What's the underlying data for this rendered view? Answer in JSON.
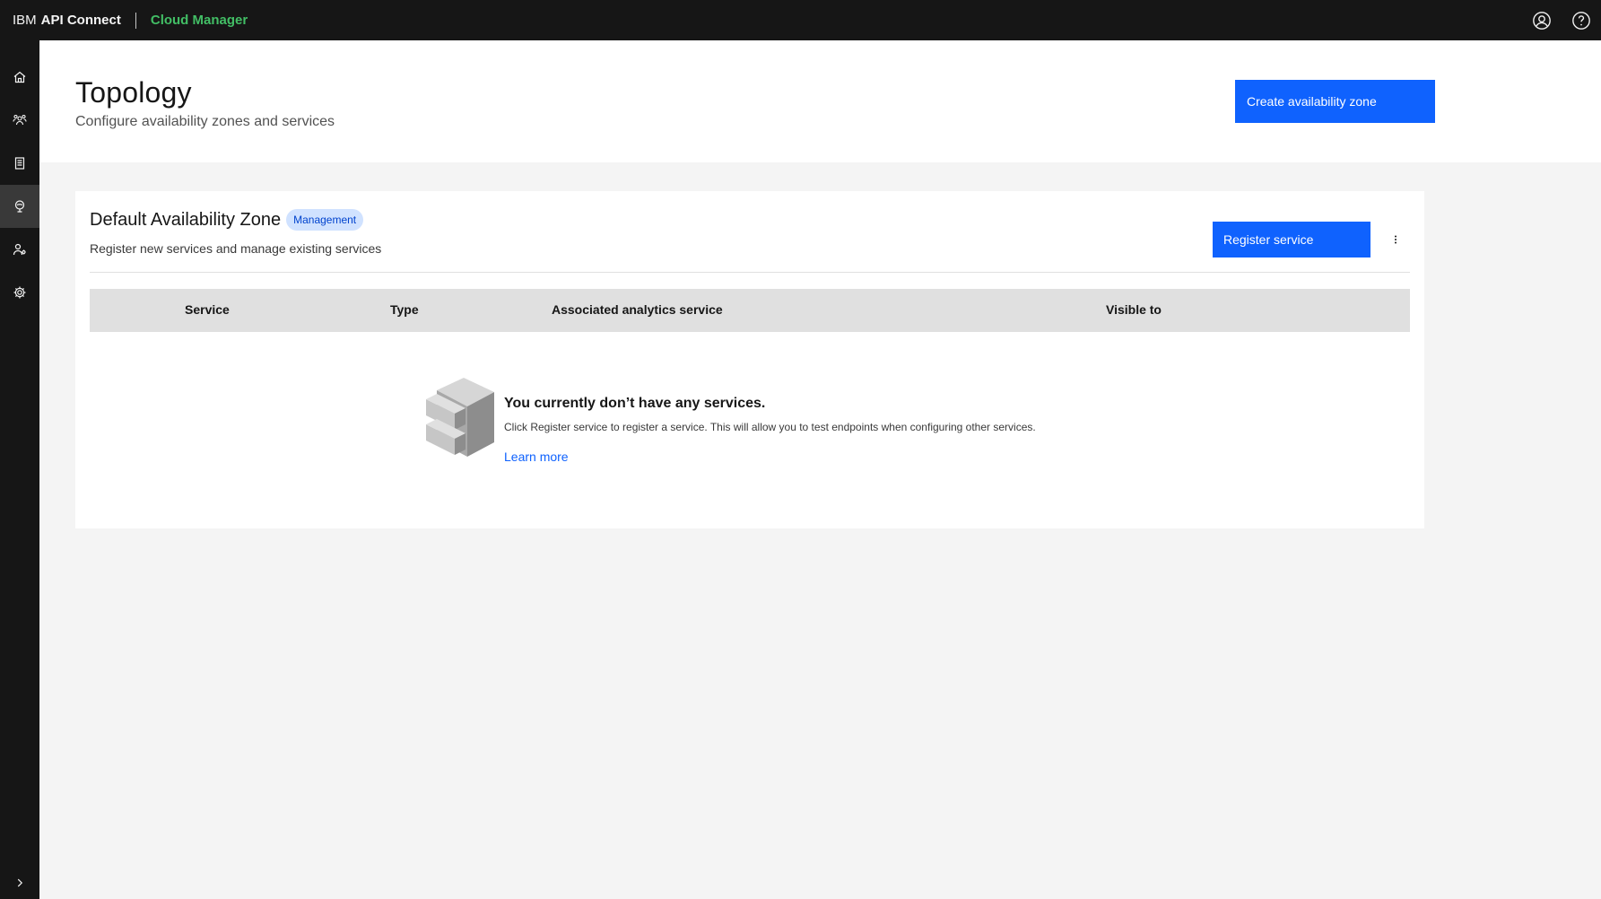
{
  "header": {
    "brand_ibm": "IBM",
    "brand_product": "API Connect",
    "brand_sub": "Cloud Manager",
    "icons": [
      "user-avatar-icon",
      "help-icon"
    ]
  },
  "sidebar": {
    "items": [
      {
        "name": "home",
        "icon": "home-icon"
      },
      {
        "name": "organizations",
        "icon": "group-icon"
      },
      {
        "name": "resources",
        "icon": "document-icon"
      },
      {
        "name": "topology",
        "icon": "globe-icon",
        "active": true
      },
      {
        "name": "members",
        "icon": "user-admin-icon"
      },
      {
        "name": "settings",
        "icon": "gear-icon"
      }
    ],
    "expand_icon": "chevron-right-icon"
  },
  "page": {
    "title": "Topology",
    "subtitle": "Configure availability zones and services",
    "create_button": "Create availability zone"
  },
  "zone": {
    "title": "Default Availability Zone",
    "tag": "Management",
    "description": "Register new services and manage existing services",
    "register_button": "Register service",
    "table": {
      "columns": [
        "Service",
        "Type",
        "Associated analytics service",
        "Visible to"
      ]
    },
    "empty": {
      "title": "You currently don’t have any services.",
      "description": "Click Register service to register a service. This will allow you to test endpoints when configuring other services.",
      "link": "Learn more"
    }
  },
  "colors": {
    "header_bg": "#161616",
    "accent": "#0f62fe",
    "brand_sub": "#42be65",
    "tag_bg": "#d0e2ff",
    "page_bg": "#f4f4f4"
  }
}
